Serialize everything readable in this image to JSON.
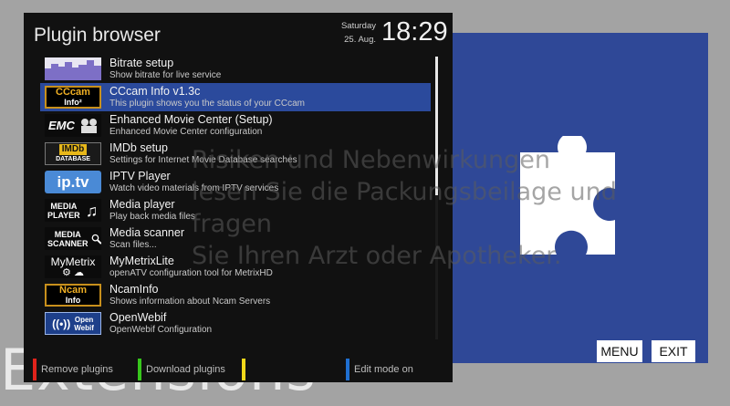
{
  "background": {
    "watermark": "Extensions",
    "overlay_text_lines": [
      "Risiken und Nebenwirkungen",
      "lesen Sie die Packungsbeilage und fragen",
      "Sie Ihren Arzt oder Apotheker."
    ]
  },
  "window": {
    "title": "Plugin browser",
    "day": "Saturday",
    "date": "25. Aug.",
    "time": "18:29"
  },
  "plugins": [
    {
      "name": "Bitrate setup",
      "description": "Show bitrate for live service",
      "icon": "bitrate-graph-icon"
    },
    {
      "name": "CCcam Info v1.3c",
      "description": "This plugin shows you the status of your CCcam",
      "icon": "cccam-info-icon",
      "icon_text": [
        "CCcam",
        "Info²"
      ]
    },
    {
      "name": "Enhanced Movie Center (Setup)",
      "description": "Enhanced Movie Center configuration",
      "icon": "emc-icon",
      "icon_text": [
        "EMC"
      ]
    },
    {
      "name": "IMDb setup",
      "description": "Settings for Internet Movie Database searches",
      "icon": "imdb-icon",
      "icon_text": [
        "IMDb",
        "DATABASE"
      ]
    },
    {
      "name": "IPTV Player",
      "description": "Watch video materials from IPTV services",
      "icon": "iptv-icon",
      "icon_text": [
        "ip.tv"
      ]
    },
    {
      "name": "Media player",
      "description": "Play back media files",
      "icon": "media-player-icon",
      "icon_text": [
        "MEDIA",
        "PLAYER"
      ]
    },
    {
      "name": "Media scanner",
      "description": "Scan files...",
      "icon": "media-scanner-icon",
      "icon_text": [
        "MEDIA",
        "SCANNER"
      ]
    },
    {
      "name": "MyMetrixLite",
      "description": "openATV configuration tool for MetrixHD",
      "icon": "mymetrix-icon",
      "icon_text": [
        "MyMetrix"
      ]
    },
    {
      "name": "NcamInfo",
      "description": "Shows information about Ncam Servers",
      "icon": "ncam-info-icon",
      "icon_text": [
        "Ncam",
        "Info"
      ]
    },
    {
      "name": "OpenWebif",
      "description": "OpenWebif Configuration",
      "icon": "openwebif-icon",
      "icon_text": [
        "Open",
        "Webif"
      ]
    }
  ],
  "selected_index": 1,
  "scroll_position": 0.0,
  "color_keys": [
    {
      "label": "Remove plugins",
      "color": "#e0231b"
    },
    {
      "label": "Download plugins",
      "color": "#37c61c"
    },
    {
      "label": "",
      "color": "#f2d81a"
    },
    {
      "label": "Edit mode on",
      "color": "#1f6fd1"
    }
  ],
  "side_panel": {
    "menu_label": "MENU",
    "exit_label": "EXIT",
    "bg_color": "#2f4897",
    "icon": "puzzle-piece-icon"
  }
}
